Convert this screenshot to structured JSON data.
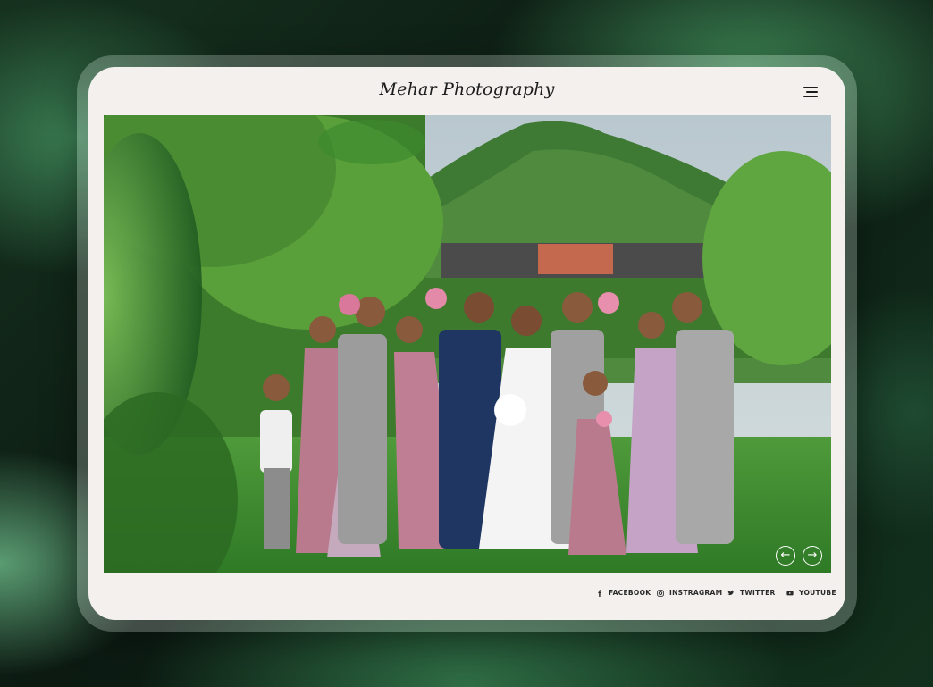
{
  "site": {
    "logo": "Mehar Photography"
  },
  "header": {
    "menu_icon": "hamburger-menu-icon"
  },
  "gallery": {
    "photo_subject": "wedding-party-group",
    "prev_icon": "arrow-left-icon",
    "next_icon": "arrow-right-icon",
    "prev_glyph": "←",
    "next_glyph": "→"
  },
  "social": [
    {
      "icon": "facebook-icon",
      "label": "FACEBOOK"
    },
    {
      "icon": "instagram-icon",
      "label": "INSTRAGRAM"
    },
    {
      "icon": "twitter-icon",
      "label": "TWITTER"
    },
    {
      "icon": "youtube-icon",
      "label": "YOUTUBE"
    }
  ],
  "colors": {
    "screen_bg": "#f3f0ed",
    "text": "#1d1d1d",
    "accent_green": "#3f8a57"
  }
}
